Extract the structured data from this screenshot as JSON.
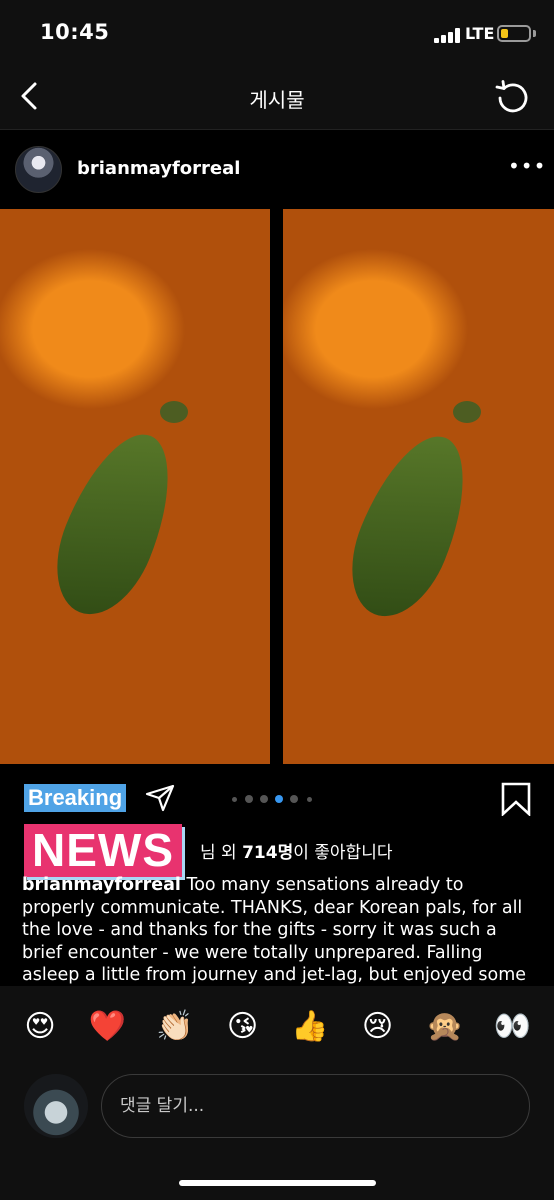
{
  "status_bar": {
    "time": "10:45",
    "network": "LTE",
    "battery_level": 0.25,
    "battery_color": "#f5c518"
  },
  "nav": {
    "title": "게시물",
    "back_icon": "chevron-left-icon",
    "refresh_icon": "refresh-icon"
  },
  "post": {
    "username": "brianmayforreal",
    "more_icon": "more-horizontal-icon",
    "carousel": {
      "total": 6,
      "active_index": 3
    },
    "overlay_text": {
      "breaking": "Breaking",
      "news": "NEWS"
    },
    "likes_prefix": "님 외 ",
    "likes_count": "714명",
    "likes_suffix": "이 좋아합니다",
    "caption_user": "brianmayforreal",
    "caption_text": " Too many sensations already to properly communicate.  THANKS, dear Korean pals, for all the love - and thanks for the gifts - sorry it was such a brief encounter - we were totally unprepared.  Falling asleep a little from journey and jet-lag, but enjoyed some"
  },
  "emoji_bar": [
    "😍",
    "❤️",
    "👏🏻",
    "😘",
    "👍",
    "😢",
    "🙊",
    "👀"
  ],
  "comment": {
    "placeholder": "댓글 달기..."
  },
  "colors": {
    "news_background": "#e8336f",
    "breaking_background": "#4fa3e6",
    "active_dot": "#3897f0"
  }
}
